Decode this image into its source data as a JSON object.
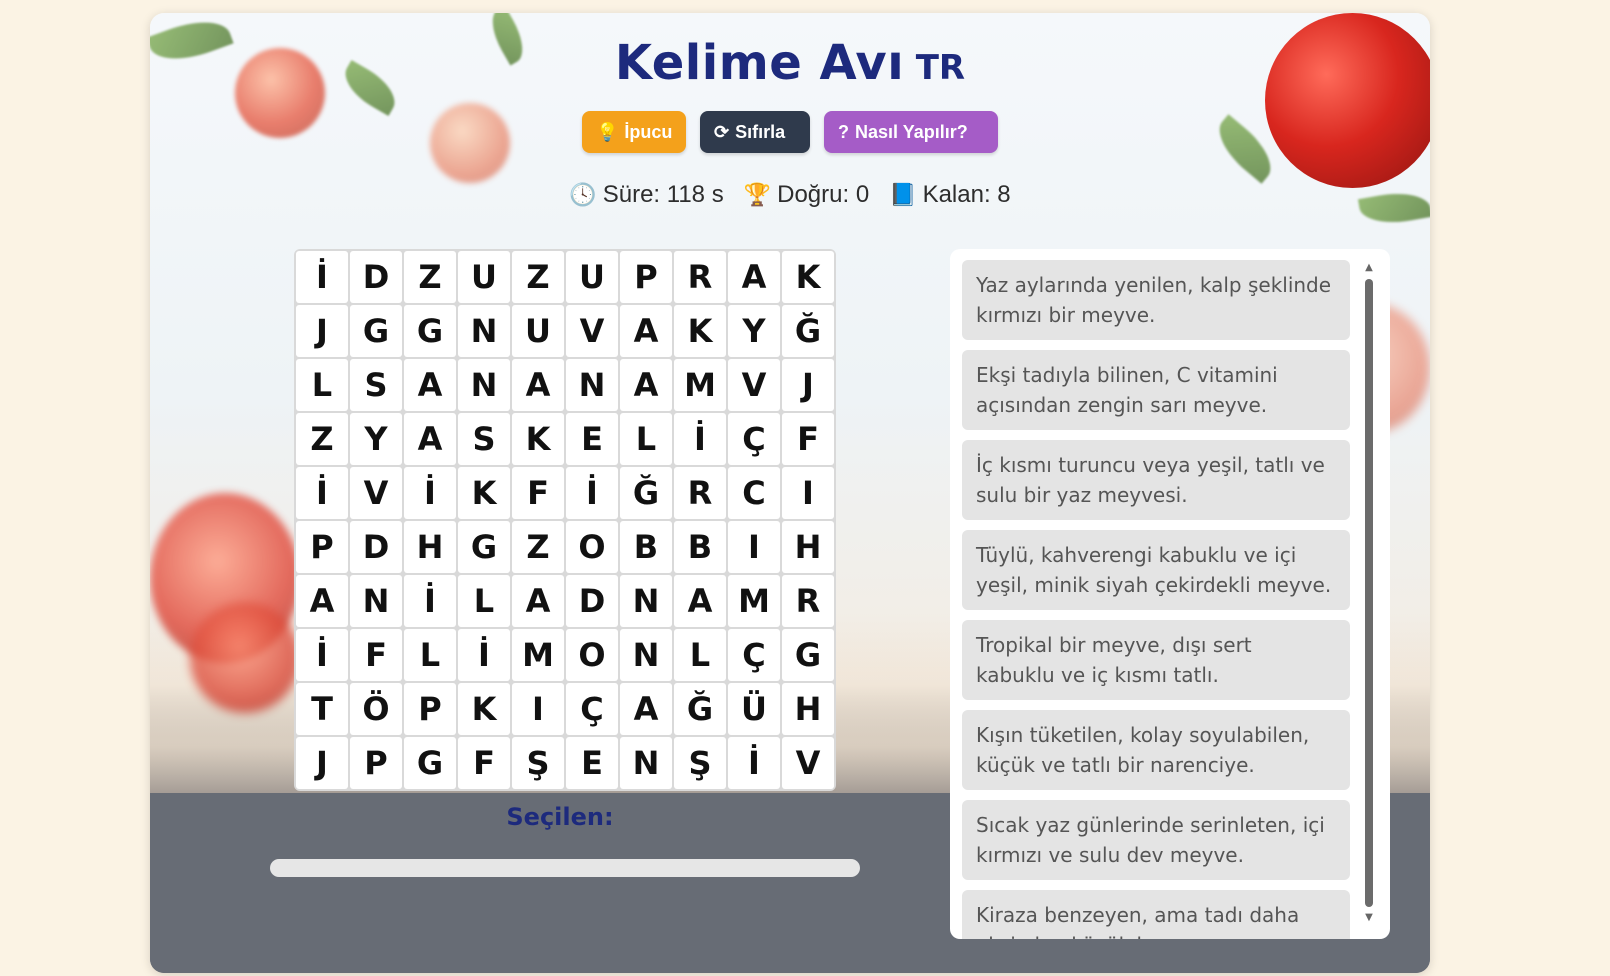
{
  "header": {
    "title": "Kelime Avı",
    "subtitle": "TR"
  },
  "buttons": {
    "hint_icon": "💡",
    "hint_label": "İpucu",
    "reset_icon": "⟳",
    "reset_label": "Sıfırla",
    "how_icon": "?",
    "how_label": "Nasıl Yapılır?"
  },
  "stats": {
    "time_icon": "🕓",
    "time_label": "Süre: 118 s",
    "correct_icon": "🏆",
    "correct_label": "Doğru: 0",
    "remaining_icon": "📘",
    "remaining_label": "Kalan: 8"
  },
  "grid": [
    [
      "İ",
      "D",
      "Z",
      "U",
      "Z",
      "U",
      "P",
      "R",
      "A",
      "K"
    ],
    [
      "J",
      "G",
      "G",
      "N",
      "U",
      "V",
      "A",
      "K",
      "Y",
      "Ğ"
    ],
    [
      "L",
      "S",
      "A",
      "N",
      "A",
      "N",
      "A",
      "M",
      "V",
      "J"
    ],
    [
      "Z",
      "Y",
      "A",
      "S",
      "K",
      "E",
      "L",
      "İ",
      "Ç",
      "F"
    ],
    [
      "İ",
      "V",
      "İ",
      "K",
      "F",
      "İ",
      "Ğ",
      "R",
      "C",
      "I"
    ],
    [
      "P",
      "D",
      "H",
      "G",
      "Z",
      "O",
      "B",
      "B",
      "I",
      "H"
    ],
    [
      "A",
      "N",
      "İ",
      "L",
      "A",
      "D",
      "N",
      "A",
      "M",
      "R"
    ],
    [
      "İ",
      "F",
      "L",
      "İ",
      "M",
      "O",
      "N",
      "L",
      "Ç",
      "G"
    ],
    [
      "T",
      "Ö",
      "P",
      "K",
      "I",
      "Ç",
      "A",
      "Ğ",
      "Ü",
      "H"
    ],
    [
      "J",
      "P",
      "G",
      "F",
      "Ş",
      "E",
      "N",
      "Ş",
      "İ",
      "V"
    ]
  ],
  "selected": {
    "label": "Seçilen:"
  },
  "clues": [
    "Yaz aylarında yenilen, kalp şeklinde kırmızı bir meyve.",
    "Ekşi tadıyla bilinen, C vitamini açısından zengin sarı meyve.",
    "İç kısmı turuncu veya yeşil, tatlı ve sulu bir yaz meyvesi.",
    "Tüylü, kahverengi kabuklu ve içi yeşil, minik siyah çekirdekli meyve.",
    "Tropikal bir meyve, dışı sert kabuklu ve iç kısmı tatlı.",
    "Kışın tüketilen, kolay soyulabilen, küçük ve tatlı bir narenciye.",
    "Sıcak yaz günlerinde serinleten, içi kırmızı ve sulu dev meyve.",
    "Kiraza benzeyen, ama tadı daha ekşi olan küçük kırmızı meyve."
  ],
  "colors": {
    "title": "#1d2a7d",
    "hint_button": "#f4a11b",
    "reset_button": "#2f3a4c",
    "how_button": "#a55cc7"
  }
}
